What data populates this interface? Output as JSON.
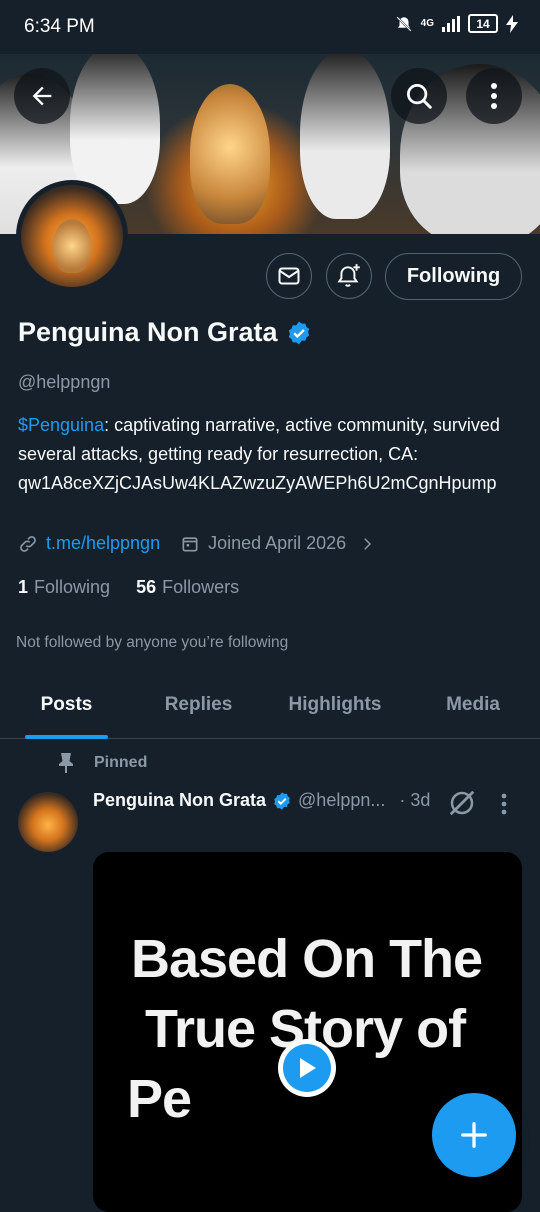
{
  "status_bar": {
    "time": "6:34 PM",
    "network": "4G",
    "battery": "14"
  },
  "profile": {
    "display_name": "Penguina Non Grata",
    "handle": "@helppngn",
    "bio_cashtag": "$Penguina",
    "bio_text": ": captivating narrative, active community, survived several attacks, getting ready for resurrection, CA: qw1A8ceXZjCJAsUw4KLAZwzuZyAWEPh6U2mCgnHpump",
    "link": "t.me/helppngn",
    "joined": "Joined April 2026",
    "following_count": "1",
    "following_label": "Following",
    "followers_count": "56",
    "followers_label": "Followers",
    "not_followed_text": "Not followed by anyone you’re following",
    "follow_button_label": "Following"
  },
  "tabs": [
    {
      "label": "Posts",
      "active": true
    },
    {
      "label": "Replies",
      "active": false
    },
    {
      "label": "Highlights",
      "active": false
    },
    {
      "label": "Media",
      "active": false
    }
  ],
  "pinned_post": {
    "pinned_label": "Pinned",
    "author_name": "Penguina Non Grata",
    "author_handle": "@helppn...",
    "time": "· 3d",
    "media_text": [
      "Based On The",
      " True Story of",
      "Pe"
    ]
  },
  "icons": {
    "back": "back-arrow-icon",
    "search": "search-icon",
    "more": "more-vertical-icon",
    "message": "envelope-icon",
    "notify": "bell-plus-icon",
    "verified": "verified-badge-icon",
    "link": "link-icon",
    "calendar": "calendar-icon",
    "pin": "pin-icon",
    "grok": "grok-icon",
    "play": "play-icon",
    "compose": "plus-icon"
  },
  "colors": {
    "background": "#15202b",
    "accent": "#1d9bf0",
    "secondary_text": "#8b98a5",
    "border": "#536471"
  }
}
